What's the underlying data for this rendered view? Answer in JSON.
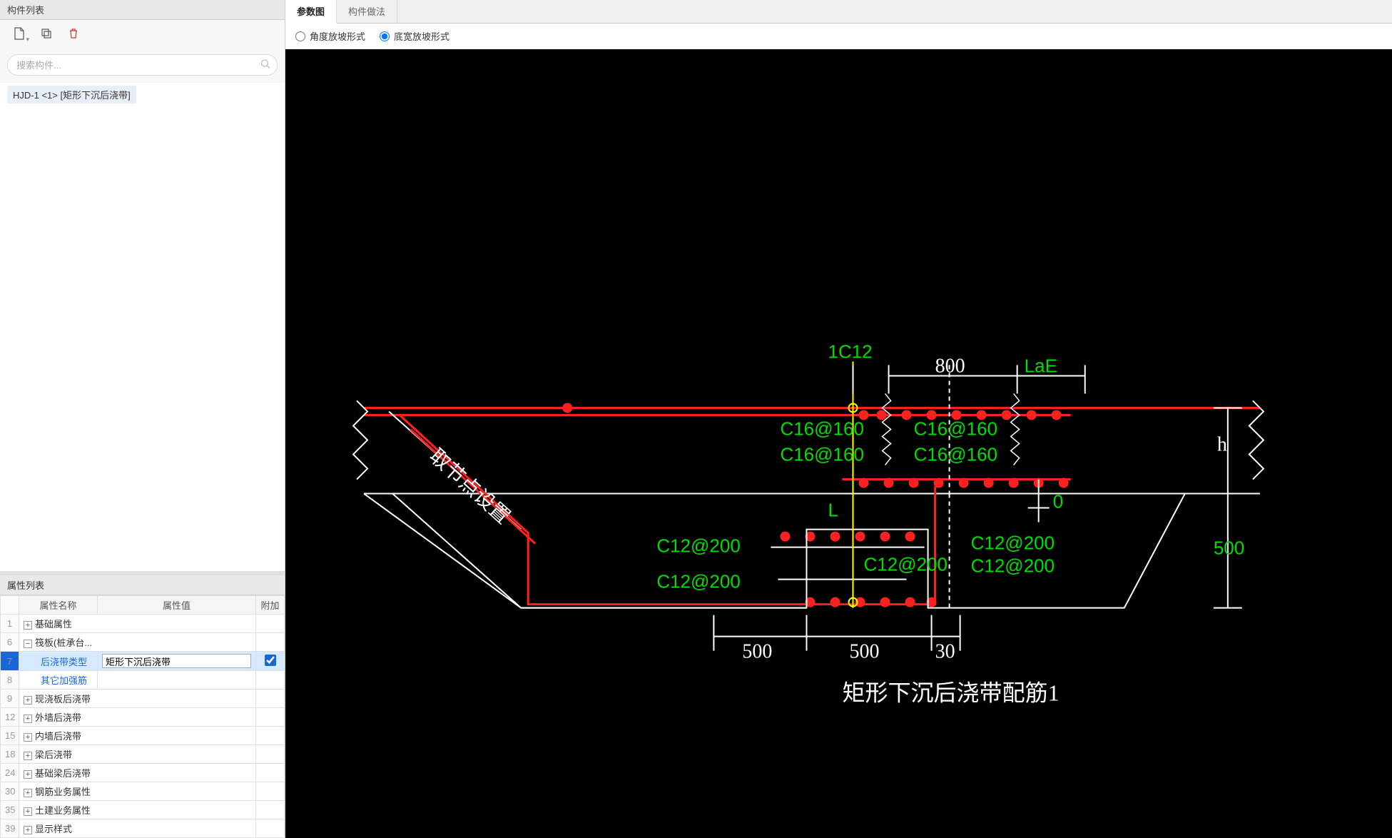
{
  "left": {
    "title": "构件列表",
    "search_placeholder": "搜索构件...",
    "component_item": "HJD-1 <1> [矩形下沉后浇带]"
  },
  "props": {
    "title": "属性列表",
    "headers": {
      "name": "属性名称",
      "value": "属性值",
      "extra": "附加"
    },
    "rows": {
      "r1": {
        "idx": "1",
        "name": "基础属性",
        "exp": "+"
      },
      "r6": {
        "idx": "6",
        "name": "筏板(桩承台...",
        "exp": "−"
      },
      "r7": {
        "idx": "7",
        "name": "后浇带类型",
        "value": "矩形下沉后浇带"
      },
      "r8": {
        "idx": "8",
        "name": "其它加强筋"
      },
      "r9": {
        "idx": "9",
        "name": "现浇板后浇带",
        "exp": "+"
      },
      "r12": {
        "idx": "12",
        "name": "外墙后浇带",
        "exp": "+"
      },
      "r15": {
        "idx": "15",
        "name": "内墙后浇带",
        "exp": "+"
      },
      "r18": {
        "idx": "18",
        "name": "梁后浇带",
        "exp": "+"
      },
      "r24": {
        "idx": "24",
        "name": "基础梁后浇带",
        "exp": "+"
      },
      "r30": {
        "idx": "30",
        "name": "钢筋业务属性",
        "exp": "+"
      },
      "r35": {
        "idx": "35",
        "name": "土建业务属性",
        "exp": "+"
      },
      "r39": {
        "idx": "39",
        "name": "显示样式",
        "exp": "+"
      }
    }
  },
  "right": {
    "tabs": {
      "t1": "参数图",
      "t2": "构件做法"
    },
    "options": {
      "o1": "角度放坡形式",
      "o2": "底宽放坡形式"
    }
  },
  "diagram": {
    "title": "矩形下沉后浇带配筋1",
    "labels": {
      "top_c": "1C12",
      "top_800": "800",
      "LaE": "LaE",
      "c16_1": "C16@160",
      "c16_2": "C16@160",
      "c16_3": "C16@160",
      "c16_4": "C16@160",
      "node_text": "取节点设置",
      "L": "L",
      "h": "h",
      "zero": "0",
      "c12_1": "C12@200",
      "c12_2": "C12@200",
      "c12_3": "C12@200",
      "c12_4": "C12@200",
      "c12_5": "C12@200",
      "d500a": "500",
      "d500b": "500",
      "d500c": "500",
      "d30": "30"
    }
  }
}
